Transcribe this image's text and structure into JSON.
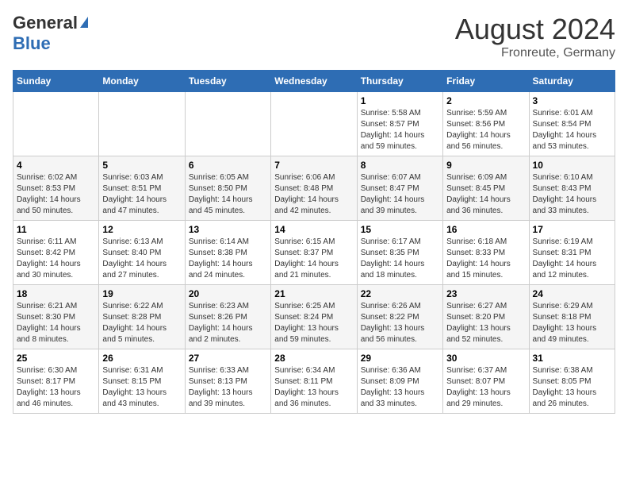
{
  "header": {
    "logo_general": "General",
    "logo_blue": "Blue",
    "month_year": "August 2024",
    "location": "Fronreute, Germany"
  },
  "calendar": {
    "days_of_week": [
      "Sunday",
      "Monday",
      "Tuesday",
      "Wednesday",
      "Thursday",
      "Friday",
      "Saturday"
    ],
    "weeks": [
      [
        {
          "day": "",
          "info": ""
        },
        {
          "day": "",
          "info": ""
        },
        {
          "day": "",
          "info": ""
        },
        {
          "day": "",
          "info": ""
        },
        {
          "day": "1",
          "info": "Sunrise: 5:58 AM\nSunset: 8:57 PM\nDaylight: 14 hours and 59 minutes."
        },
        {
          "day": "2",
          "info": "Sunrise: 5:59 AM\nSunset: 8:56 PM\nDaylight: 14 hours and 56 minutes."
        },
        {
          "day": "3",
          "info": "Sunrise: 6:01 AM\nSunset: 8:54 PM\nDaylight: 14 hours and 53 minutes."
        }
      ],
      [
        {
          "day": "4",
          "info": "Sunrise: 6:02 AM\nSunset: 8:53 PM\nDaylight: 14 hours and 50 minutes."
        },
        {
          "day": "5",
          "info": "Sunrise: 6:03 AM\nSunset: 8:51 PM\nDaylight: 14 hours and 47 minutes."
        },
        {
          "day": "6",
          "info": "Sunrise: 6:05 AM\nSunset: 8:50 PM\nDaylight: 14 hours and 45 minutes."
        },
        {
          "day": "7",
          "info": "Sunrise: 6:06 AM\nSunset: 8:48 PM\nDaylight: 14 hours and 42 minutes."
        },
        {
          "day": "8",
          "info": "Sunrise: 6:07 AM\nSunset: 8:47 PM\nDaylight: 14 hours and 39 minutes."
        },
        {
          "day": "9",
          "info": "Sunrise: 6:09 AM\nSunset: 8:45 PM\nDaylight: 14 hours and 36 minutes."
        },
        {
          "day": "10",
          "info": "Sunrise: 6:10 AM\nSunset: 8:43 PM\nDaylight: 14 hours and 33 minutes."
        }
      ],
      [
        {
          "day": "11",
          "info": "Sunrise: 6:11 AM\nSunset: 8:42 PM\nDaylight: 14 hours and 30 minutes."
        },
        {
          "day": "12",
          "info": "Sunrise: 6:13 AM\nSunset: 8:40 PM\nDaylight: 14 hours and 27 minutes."
        },
        {
          "day": "13",
          "info": "Sunrise: 6:14 AM\nSunset: 8:38 PM\nDaylight: 14 hours and 24 minutes."
        },
        {
          "day": "14",
          "info": "Sunrise: 6:15 AM\nSunset: 8:37 PM\nDaylight: 14 hours and 21 minutes."
        },
        {
          "day": "15",
          "info": "Sunrise: 6:17 AM\nSunset: 8:35 PM\nDaylight: 14 hours and 18 minutes."
        },
        {
          "day": "16",
          "info": "Sunrise: 6:18 AM\nSunset: 8:33 PM\nDaylight: 14 hours and 15 minutes."
        },
        {
          "day": "17",
          "info": "Sunrise: 6:19 AM\nSunset: 8:31 PM\nDaylight: 14 hours and 12 minutes."
        }
      ],
      [
        {
          "day": "18",
          "info": "Sunrise: 6:21 AM\nSunset: 8:30 PM\nDaylight: 14 hours and 8 minutes."
        },
        {
          "day": "19",
          "info": "Sunrise: 6:22 AM\nSunset: 8:28 PM\nDaylight: 14 hours and 5 minutes."
        },
        {
          "day": "20",
          "info": "Sunrise: 6:23 AM\nSunset: 8:26 PM\nDaylight: 14 hours and 2 minutes."
        },
        {
          "day": "21",
          "info": "Sunrise: 6:25 AM\nSunset: 8:24 PM\nDaylight: 13 hours and 59 minutes."
        },
        {
          "day": "22",
          "info": "Sunrise: 6:26 AM\nSunset: 8:22 PM\nDaylight: 13 hours and 56 minutes."
        },
        {
          "day": "23",
          "info": "Sunrise: 6:27 AM\nSunset: 8:20 PM\nDaylight: 13 hours and 52 minutes."
        },
        {
          "day": "24",
          "info": "Sunrise: 6:29 AM\nSunset: 8:18 PM\nDaylight: 13 hours and 49 minutes."
        }
      ],
      [
        {
          "day": "25",
          "info": "Sunrise: 6:30 AM\nSunset: 8:17 PM\nDaylight: 13 hours and 46 minutes."
        },
        {
          "day": "26",
          "info": "Sunrise: 6:31 AM\nSunset: 8:15 PM\nDaylight: 13 hours and 43 minutes."
        },
        {
          "day": "27",
          "info": "Sunrise: 6:33 AM\nSunset: 8:13 PM\nDaylight: 13 hours and 39 minutes."
        },
        {
          "day": "28",
          "info": "Sunrise: 6:34 AM\nSunset: 8:11 PM\nDaylight: 13 hours and 36 minutes."
        },
        {
          "day": "29",
          "info": "Sunrise: 6:36 AM\nSunset: 8:09 PM\nDaylight: 13 hours and 33 minutes."
        },
        {
          "day": "30",
          "info": "Sunrise: 6:37 AM\nSunset: 8:07 PM\nDaylight: 13 hours and 29 minutes."
        },
        {
          "day": "31",
          "info": "Sunrise: 6:38 AM\nSunset: 8:05 PM\nDaylight: 13 hours and 26 minutes."
        }
      ]
    ]
  }
}
